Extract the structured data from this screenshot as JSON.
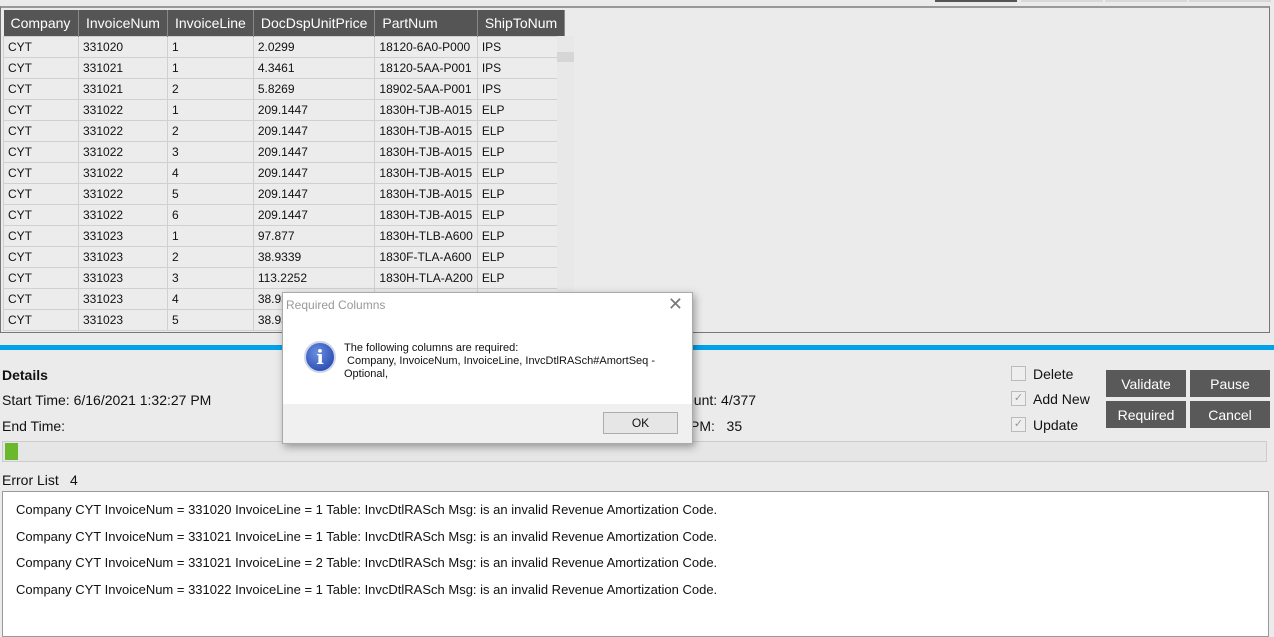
{
  "grid": {
    "columns": [
      "Company",
      "InvoiceNum",
      "InvoiceLine",
      "DocDspUnitPrice",
      "PartNum",
      "ShipToNum"
    ],
    "rows": [
      [
        "CYT",
        "331020",
        "1",
        "2.0299",
        "18120-6A0-P000",
        "IPS"
      ],
      [
        "CYT",
        "331021",
        "1",
        "4.3461",
        "18120-5AA-P001",
        "IPS"
      ],
      [
        "CYT",
        "331021",
        "2",
        "5.8269",
        "18902-5AA-P001",
        "IPS"
      ],
      [
        "CYT",
        "331022",
        "1",
        "209.1447",
        "1830H-TJB-A015",
        "ELP"
      ],
      [
        "CYT",
        "331022",
        "2",
        "209.1447",
        "1830H-TJB-A015",
        "ELP"
      ],
      [
        "CYT",
        "331022",
        "3",
        "209.1447",
        "1830H-TJB-A015",
        "ELP"
      ],
      [
        "CYT",
        "331022",
        "4",
        "209.1447",
        "1830H-TJB-A015",
        "ELP"
      ],
      [
        "CYT",
        "331022",
        "5",
        "209.1447",
        "1830H-TJB-A015",
        "ELP"
      ],
      [
        "CYT",
        "331022",
        "6",
        "209.1447",
        "1830H-TJB-A015",
        "ELP"
      ],
      [
        "CYT",
        "331023",
        "1",
        "97.877",
        "1830H-TLB-A600",
        "ELP"
      ],
      [
        "CYT",
        "331023",
        "2",
        "38.9339",
        "1830F-TLA-A600",
        "ELP"
      ],
      [
        "CYT",
        "331023",
        "3",
        "113.2252",
        "1830H-TLA-A200",
        "ELP"
      ],
      [
        "CYT",
        "331023",
        "4",
        "38.93",
        "",
        ""
      ],
      [
        "CYT",
        "331023",
        "5",
        "38.93",
        "",
        ""
      ]
    ]
  },
  "details": {
    "title": "Details",
    "start_time": "Start Time: 6/16/2021 1:32:27 PM",
    "end_time": "End Time:",
    "count": "ount: 4/377",
    "rpm": "PM:   35",
    "progress_percent": 1.06,
    "progress_color": "#6ab82c"
  },
  "options": {
    "delete": {
      "label": "Delete",
      "checked": false
    },
    "add_new": {
      "label": "Add New",
      "checked": true
    },
    "update": {
      "label": "Update",
      "checked": true
    }
  },
  "buttons": {
    "validate": "Validate",
    "pause": "Pause",
    "required": "Required",
    "cancel": "Cancel"
  },
  "errors": {
    "label": "Error List",
    "count": "4",
    "items": [
      "Company CYT InvoiceNum = 331020 InvoiceLine = 1  Table: InvcDtlRASch Msg:  is an invalid Revenue Amortization Code.",
      "Company CYT InvoiceNum = 331021 InvoiceLine = 1  Table: InvcDtlRASch Msg:  is an invalid Revenue Amortization Code.",
      "Company CYT InvoiceNum = 331021 InvoiceLine = 2  Table: InvcDtlRASch Msg:  is an invalid Revenue Amortization Code.",
      "Company CYT InvoiceNum = 331022 InvoiceLine = 1  Table: InvcDtlRASch Msg:  is an invalid Revenue Amortization Code."
    ]
  },
  "dialog": {
    "title": "Required Columns",
    "close": "✕",
    "icon": "info-icon",
    "line1": "The following columns are required:",
    "line2": " Company, InvoiceNum, InvoiceLine, InvcDtlRASch#AmortSeq -",
    "line3": "Optional,",
    "ok": "OK"
  },
  "colors": {
    "accent": "#00a2e8",
    "button": "#595959",
    "header": "#555555"
  }
}
